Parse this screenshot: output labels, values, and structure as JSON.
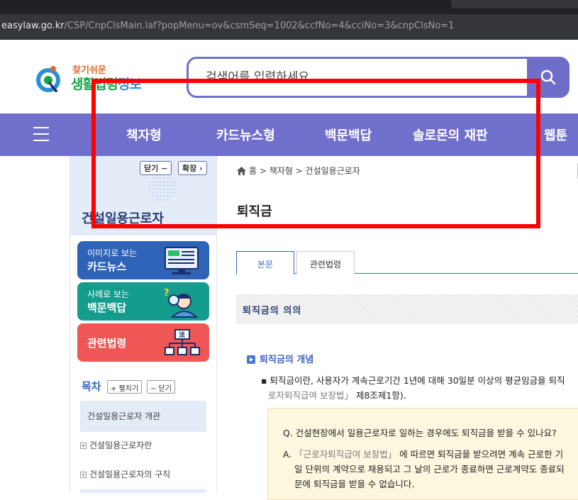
{
  "browser": {
    "url_host": "easylaw.go.kr",
    "url_path": "/CSP/CnpClsMain.laf?popMenu=ov&csmSeq=1002&ccfNo=4&cciNo=3&cnpClsNo=1"
  },
  "logo": {
    "small": "찾기쉬운",
    "big_a": "생활법령",
    "big_b": "정보"
  },
  "search": {
    "placeholder": "검색어를 입력하세요"
  },
  "nav": {
    "items": [
      "책자형",
      "카드뉴스형",
      "백문백답",
      "솔로몬의 재판",
      "웹툰"
    ]
  },
  "sidebar": {
    "close_btn": "닫기 −",
    "expand_btn": "확장 ›",
    "title": "건설일용근로자",
    "cards": [
      {
        "line1": "이미지로 보는",
        "line2": "카드뉴스",
        "color": "#2e63b8"
      },
      {
        "line1": "사례로 보는",
        "line2": "백문백답",
        "color": "#149c8c"
      },
      {
        "line1": "",
        "line2": "관련법령",
        "color": "#ef5656"
      }
    ],
    "toc_title": "목차",
    "toc_expand": "+ 펼치기",
    "toc_close": "− 닫기",
    "toc_items": [
      "건설일용근로자 개관",
      "건설일용근로자란",
      "건설일용근로자의 구직"
    ]
  },
  "main": {
    "breadcrumb": "홈 > 책자형 > 건설일용근로자",
    "page_title": "퇴직금",
    "tabs": [
      "본문",
      "관련법령"
    ],
    "section_title": "퇴직금의 의의",
    "subheading": "퇴직금의 개념",
    "para_line1": "▪ 퇴직금이란, 사용자가 계속근로기간 1년에 대해 30일분 이상의 평균임금을 퇴직",
    "para_line2_law": "로자퇴직급여 보장법」",
    "para_line2_rest": " 제8조제1항).",
    "qa_q": "Q. 건설현장에서 일용근로자로 일하는 경우에도 퇴직금을 받을 수 있나요?",
    "qa_a1_prefix": "A. ",
    "qa_a1_law": "「근로자퇴직급여 보장법」",
    "qa_a1_rest": " 에 따르면 퇴직금을 받으려면 계속 근로한 기",
    "qa_a2": "일 단위의 계약으로 채용되고 그 날의 근로가 종료하면 근로계약도 종료되",
    "qa_a3": "문에 퇴직금을 받을 수 없습니다."
  },
  "colors": {
    "accent": "#7070cc",
    "highlight_box": "#ff0000",
    "link_blue": "#3a63c4"
  }
}
